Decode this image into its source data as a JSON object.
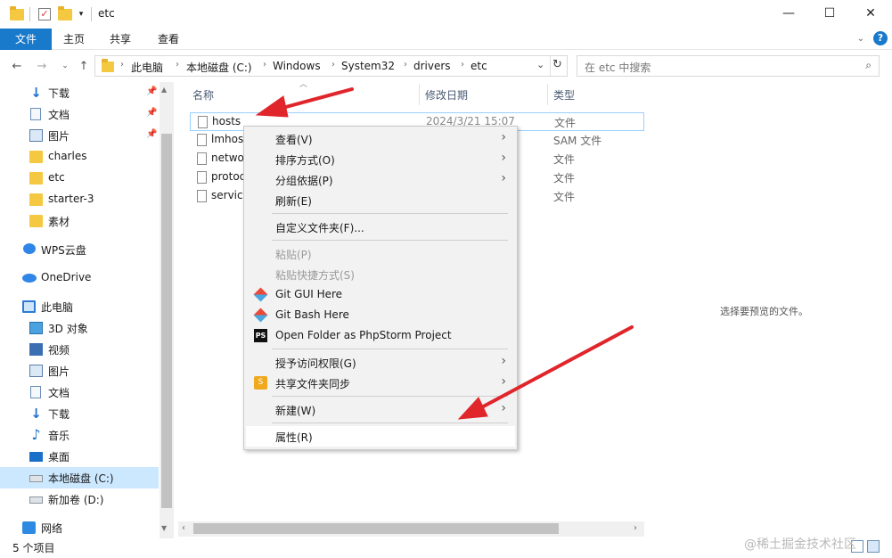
{
  "window": {
    "title": "etc",
    "controls": {
      "minimize": "—",
      "maximize": "☐",
      "close": "✕"
    }
  },
  "ribbon": {
    "tabs": [
      "文件",
      "主页",
      "共享",
      "查看"
    ],
    "help": "?"
  },
  "address": {
    "crumbs": [
      "此电脑",
      "本地磁盘 (C:)",
      "Windows",
      "System32",
      "drivers",
      "etc"
    ],
    "search_placeholder": "在 etc 中搜索"
  },
  "sidebar": {
    "items": [
      {
        "label": "下载",
        "icon": "download-icon",
        "pinned": true
      },
      {
        "label": "文档",
        "icon": "document-icon",
        "pinned": true
      },
      {
        "label": "图片",
        "icon": "picture-icon",
        "pinned": true
      },
      {
        "label": "charles",
        "icon": "folder-icon"
      },
      {
        "label": "etc",
        "icon": "folder-icon"
      },
      {
        "label": "starter-3",
        "icon": "folder-icon"
      },
      {
        "label": "素材",
        "icon": "folder-icon"
      },
      {
        "label": "WPS云盘",
        "icon": "cloud-icon"
      },
      {
        "label": "OneDrive",
        "icon": "onedrive-icon"
      },
      {
        "label": "此电脑",
        "icon": "computer-icon"
      },
      {
        "label": "3D 对象",
        "icon": "3d-objects-icon"
      },
      {
        "label": "视频",
        "icon": "video-icon"
      },
      {
        "label": "图片",
        "icon": "picture-icon"
      },
      {
        "label": "文档",
        "icon": "document-icon"
      },
      {
        "label": "下载",
        "icon": "download-icon"
      },
      {
        "label": "音乐",
        "icon": "music-icon"
      },
      {
        "label": "桌面",
        "icon": "desktop-icon"
      },
      {
        "label": "本地磁盘 (C:)",
        "icon": "drive-icon",
        "selected": true
      },
      {
        "label": "新加卷 (D:)",
        "icon": "drive-icon"
      },
      {
        "label": "网络",
        "icon": "network-icon"
      }
    ]
  },
  "columns": {
    "name": "名称",
    "modified": "修改日期",
    "type": "类型"
  },
  "files": [
    {
      "name": "hosts",
      "modified": "2024/3/21 15:07",
      "type": "文件"
    },
    {
      "name": "lmhost",
      "modified": "",
      "type": "SAM 文件"
    },
    {
      "name": "netwo",
      "modified": "",
      "type": "文件"
    },
    {
      "name": "protoc",
      "modified": "",
      "type": "文件"
    },
    {
      "name": "service",
      "modified": "",
      "type": "文件"
    }
  ],
  "preview_text": "选择要预览的文件。",
  "status": {
    "count": "5 个项目"
  },
  "context_menu": [
    {
      "label": "查看(V)",
      "submenu": true
    },
    {
      "label": "排序方式(O)",
      "submenu": true
    },
    {
      "label": "分组依据(P)",
      "submenu": true
    },
    {
      "label": "刷新(E)"
    },
    {
      "label": "自定义文件夹(F)..."
    },
    {
      "label": "粘贴(P)",
      "disabled": true
    },
    {
      "label": "粘贴快捷方式(S)",
      "disabled": true
    },
    {
      "label": "Git GUI Here",
      "icon": "git-icon"
    },
    {
      "label": "Git Bash Here",
      "icon": "git-icon"
    },
    {
      "label": "Open Folder as PhpStorm Project",
      "icon": "phpstorm-icon"
    },
    {
      "label": "授予访问权限(G)",
      "submenu": true
    },
    {
      "label": "共享文件夹同步",
      "submenu": true,
      "icon": "share-sync-icon"
    },
    {
      "label": "新建(W)",
      "submenu": true
    },
    {
      "label": "属性(R)"
    }
  ],
  "annotation_color": "#e0252b",
  "watermark": "@稀土掘金技术社区"
}
